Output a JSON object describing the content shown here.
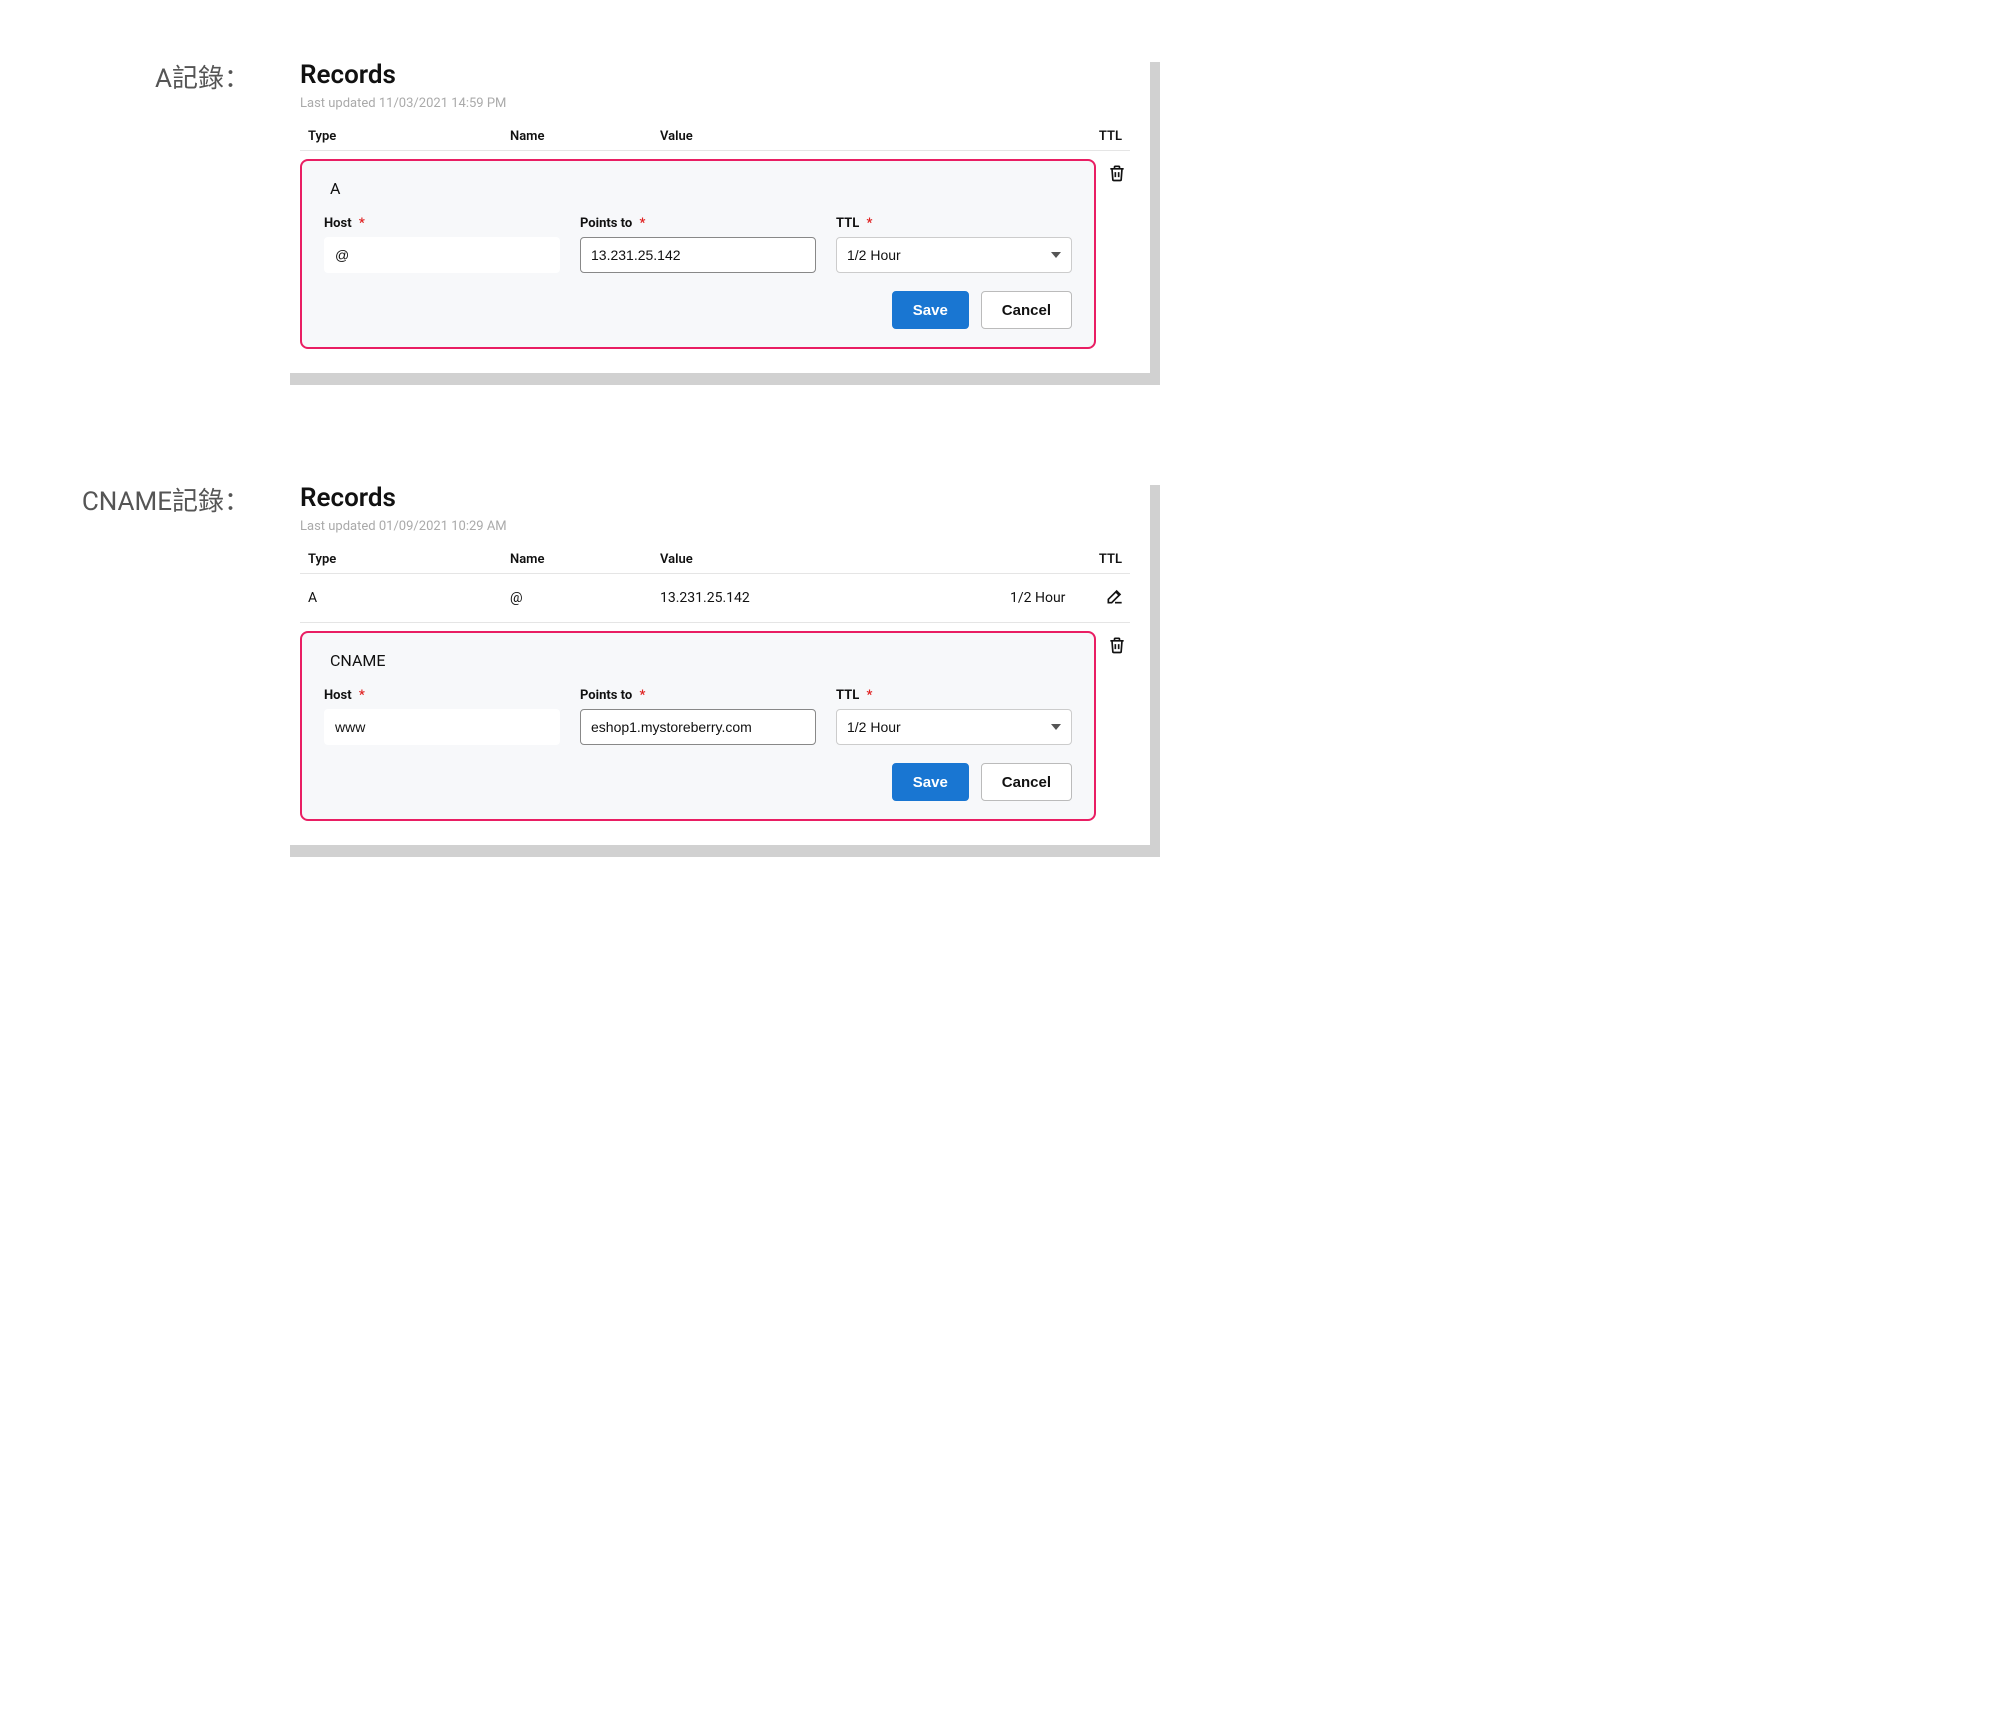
{
  "labels": {
    "a_record_side": "A記錄：",
    "cname_record_side": "CNAME記錄："
  },
  "panelA": {
    "title": "Records",
    "last_updated": "Last updated 11/03/2021 14:59 PM",
    "headers": {
      "type": "Type",
      "name": "Name",
      "value": "Value",
      "ttl": "TTL"
    },
    "edit": {
      "record_type": "A",
      "host_label": "Host",
      "host_value": "@",
      "points_to_label": "Points to",
      "points_to_value": "13.231.25.142",
      "ttl_label": "TTL",
      "ttl_value": "1/2 Hour",
      "save_label": "Save",
      "cancel_label": "Cancel",
      "required_marker": "*"
    }
  },
  "panelB": {
    "title": "Records",
    "last_updated": "Last updated 01/09/2021 10:29 AM",
    "headers": {
      "type": "Type",
      "name": "Name",
      "value": "Value",
      "ttl": "TTL"
    },
    "row": {
      "type": "A",
      "name": "@",
      "value": "13.231.25.142",
      "ttl": "1/2 Hour"
    },
    "edit": {
      "record_type": "CNAME",
      "host_label": "Host",
      "host_value": "www",
      "points_to_label": "Points to",
      "points_to_value": "eshop1.mystoreberry.com",
      "ttl_label": "TTL",
      "ttl_value": "1/2 Hour",
      "save_label": "Save",
      "cancel_label": "Cancel",
      "required_marker": "*"
    }
  },
  "colors": {
    "highlight_border": "#e91e63",
    "primary_button": "#1976d2"
  }
}
